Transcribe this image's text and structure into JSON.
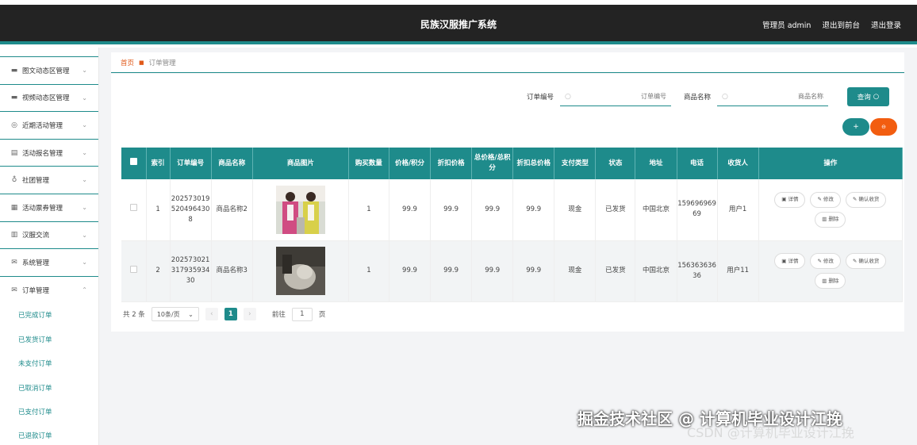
{
  "header": {
    "title": "民族汉服推广系统",
    "admin": "管理员 admin",
    "to_front": "退出到前台",
    "logout": "退出登录"
  },
  "sidebar": {
    "items": [
      {
        "label": "图文动态区管理",
        "icon": "monitor-icon"
      },
      {
        "label": "视频动态区管理",
        "icon": "monitor-icon"
      },
      {
        "label": "近期活动管理",
        "icon": "globe-icon"
      },
      {
        "label": "活动报名管理",
        "icon": "chart-icon"
      },
      {
        "label": "社团管理",
        "icon": "mic-icon"
      },
      {
        "label": "活动票券管理",
        "icon": "document-icon"
      },
      {
        "label": "汉服交流",
        "icon": "bar-icon"
      },
      {
        "label": "系统管理",
        "icon": "mail-icon"
      },
      {
        "label": "订单管理",
        "icon": "mail-icon"
      }
    ],
    "subitems": [
      "已完成订单",
      "已发货订单",
      "未支付订单",
      "已取消订单",
      "已支付订单",
      "已退款订单"
    ]
  },
  "breadcrumb": {
    "home": "首页",
    "current": "订单管理"
  },
  "search": {
    "order_label": "订单编号",
    "order_placeholder": "订单编号",
    "name_label": "商品名称",
    "name_placeholder": "商品名称",
    "query_label": "查询"
  },
  "actions": {
    "add": "+",
    "delete": "⊖"
  },
  "table": {
    "headers": [
      "索引",
      "订单编号",
      "商品名称",
      "商品图片",
      "购买数量",
      "价格/积分",
      "折扣价格",
      "总价格/总积分",
      "折扣总价格",
      "支付类型",
      "状态",
      "地址",
      "电话",
      "收货人",
      "操作"
    ],
    "rows": [
      {
        "index": "1",
        "order_no": "2025730195204964308",
        "name": "商品名称2",
        "qty": "1",
        "price": "99.9",
        "discount": "99.9",
        "total": "99.9",
        "discount_total": "99.9",
        "pay": "现金",
        "status": "已发货",
        "addr": "中国北京",
        "phone": "15969696969",
        "receiver": "用户1"
      },
      {
        "index": "2",
        "order_no": "20257302131793593430",
        "name": "商品名称3",
        "qty": "1",
        "price": "99.9",
        "discount": "99.9",
        "total": "99.9",
        "discount_total": "99.9",
        "pay": "现金",
        "status": "已发货",
        "addr": "中国北京",
        "phone": "15636363636",
        "receiver": "用户11"
      }
    ],
    "ops": {
      "detail": "详情",
      "edit": "修改",
      "confirm": "确认收货",
      "delete": "删除"
    }
  },
  "pager": {
    "total": "共 2 条",
    "size": "10条/页",
    "page": "1",
    "goto": "前往",
    "goto_val": "1",
    "unit": "页"
  },
  "watermark": {
    "line1": "掘金技术社区 @ 计算机毕业设计江挽",
    "line2": "CSDN @计算机毕业设计江挽"
  },
  "colors": {
    "accent": "#1e8b8b",
    "danger": "#f25d10",
    "header": "#232323"
  }
}
